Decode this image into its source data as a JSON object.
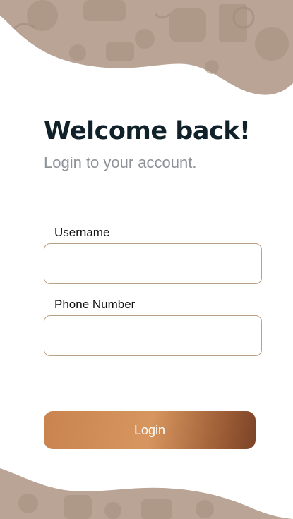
{
  "header": {
    "title": "Welcome back!",
    "subtitle": "Login to your account."
  },
  "form": {
    "username": {
      "label": "Username",
      "value": "",
      "placeholder": ""
    },
    "phone": {
      "label": "Phone Number",
      "value": "",
      "placeholder": ""
    },
    "login_label": "Login"
  },
  "decoration": {
    "top": "coffee-pattern-wave",
    "bottom": "coffee-pattern-wave"
  },
  "colors": {
    "heading": "#10212a",
    "subtitle": "#8c9297",
    "field_border": "#b9a089",
    "button_start": "#c9834f",
    "button_end": "#7b4327",
    "wave": "#b9a496"
  }
}
